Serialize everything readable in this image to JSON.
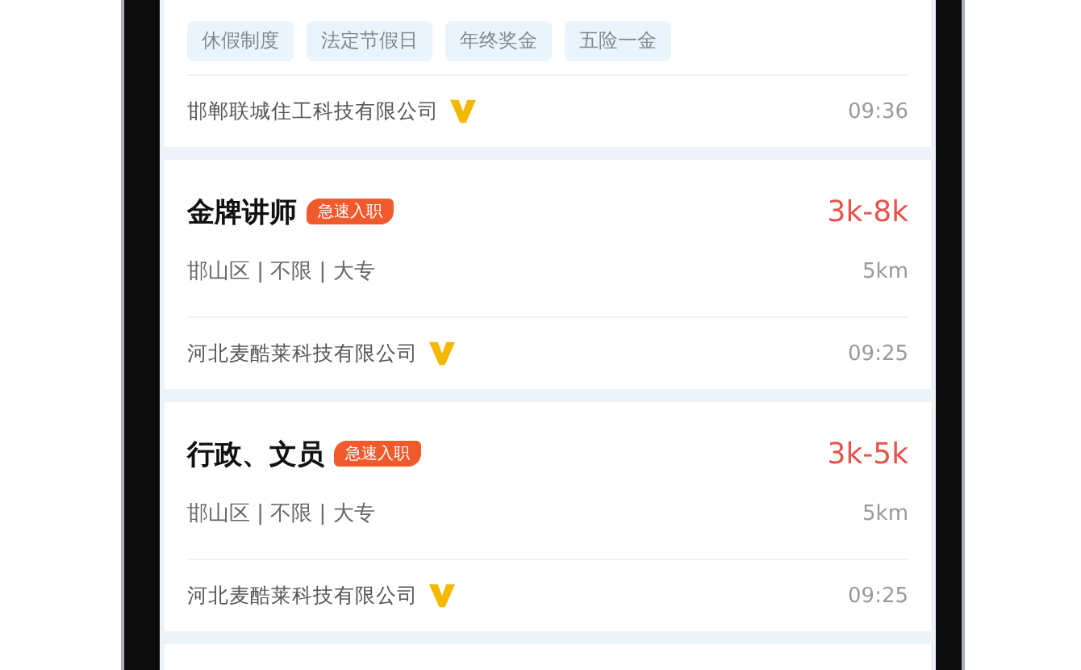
{
  "top_card": {
    "tags": [
      "休假制度",
      "法定节假日",
      "年终奖金",
      "五险一金"
    ],
    "company": "邯郸联城住工科技有限公司",
    "verified": true,
    "time": "09:36"
  },
  "jobs": [
    {
      "title": "金牌讲师",
      "badge": "急速入职",
      "salary": "3k-8k",
      "meta": "邯山区 | 不限 | 大专",
      "distance": "5km",
      "company": "河北麦酷莱科技有限公司",
      "verified": true,
      "time": "09:25"
    },
    {
      "title": "行政、文员",
      "badge": "急速入职",
      "salary": "3k-5k",
      "meta": "邯山区 | 不限 | 大专",
      "distance": "5km",
      "company": "河北麦酷莱科技有限公司",
      "verified": true,
      "time": "09:25"
    }
  ]
}
